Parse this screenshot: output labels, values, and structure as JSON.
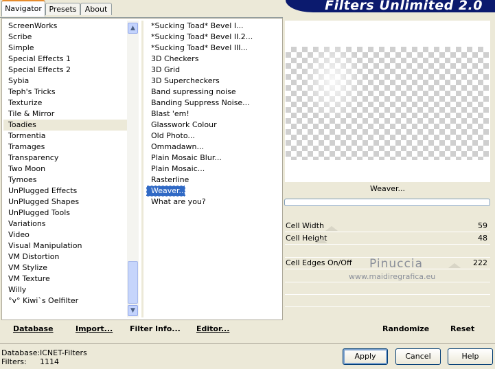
{
  "tabs": [
    {
      "label": "Navigator",
      "active": true
    },
    {
      "label": "Presets",
      "active": false
    },
    {
      "label": "About",
      "active": false
    }
  ],
  "app_title": "Filters Unlimited 2.0",
  "categories": [
    "ScreenWorks",
    "Scribe",
    "Simple",
    "Special Effects 1",
    "Special Effects 2",
    "Sybia",
    "Teph's Tricks",
    "Texturize",
    "Tile & Mirror",
    "Toadies",
    "Tormentia",
    "Tramages",
    "Transparency",
    "Two Moon",
    "Tymoes",
    "UnPlugged Effects",
    "UnPlugged Shapes",
    "UnPlugged Tools",
    "Variations",
    "Video",
    "Visual Manipulation",
    "VM Distortion",
    "VM Stylize",
    "VM Texture",
    "Willy",
    "°v° Kiwi`s Oelfilter"
  ],
  "selected_category": "Toadies",
  "filters": [
    "*Sucking Toad*  Bevel I...",
    "*Sucking Toad*  Bevel II.2...",
    "*Sucking Toad*  Bevel III...",
    "3D Checkers",
    "3D Grid",
    "3D Superchecker s",
    "Band supressing noise",
    "Banding Suppress Noise...",
    "Blast 'em!",
    "Glasswork Colour",
    "Old Photo...",
    "Ommadawn...",
    "Plain Mosaic Blur...",
    "Plain Mosaic...",
    "Rasterline",
    "Weaver...",
    "What are you?"
  ],
  "selected_filter": "Weaver...",
  "preview": {
    "filter_name": "Weaver...",
    "progress": 0
  },
  "params": [
    {
      "label": "Cell Width",
      "value": "59",
      "level": 59
    },
    {
      "label": "Cell Height",
      "value": "48",
      "level": 48
    },
    {
      "label": "Cell Edges On/Off",
      "value": "222",
      "level": 222
    }
  ],
  "watermark": {
    "line1": "Pinuccia",
    "line2": "www.maidiregrafica.eu"
  },
  "commands": {
    "database": "Database",
    "import": "Import...",
    "filter_info": "Filter Info...",
    "editor": "Editor...",
    "randomize": "Randomize",
    "reset": "Reset"
  },
  "status": {
    "database_label": "Database:",
    "database_value": "ICNET-Filters",
    "filters_label": "Filters:",
    "filters_value": "1114"
  },
  "buttons": {
    "apply": "Apply",
    "cancel": "Cancel",
    "help": "Help"
  },
  "icons": {
    "scroll_up": "arrow-up-icon",
    "scroll_down": "arrow-down-icon"
  }
}
